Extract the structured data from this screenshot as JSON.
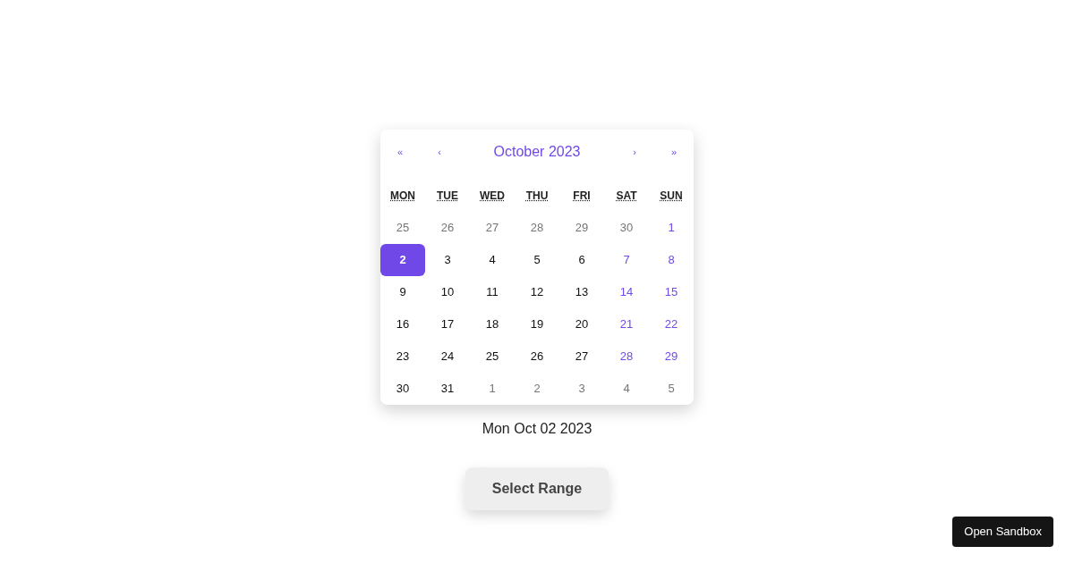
{
  "calendar": {
    "nav": {
      "prev_year": "«",
      "prev_month": "‹",
      "title": "October 2023",
      "next_month": "›",
      "next_year": "»"
    },
    "weekdays": [
      "MON",
      "TUE",
      "WED",
      "THU",
      "FRI",
      "SAT",
      "SUN"
    ],
    "weeks": [
      [
        {
          "day": "25",
          "kind": "outside",
          "selected": false
        },
        {
          "day": "26",
          "kind": "outside",
          "selected": false
        },
        {
          "day": "27",
          "kind": "outside",
          "selected": false
        },
        {
          "day": "28",
          "kind": "outside",
          "selected": false
        },
        {
          "day": "29",
          "kind": "outside",
          "selected": false
        },
        {
          "day": "30",
          "kind": "outside",
          "selected": false
        },
        {
          "day": "1",
          "kind": "weekend",
          "selected": false
        }
      ],
      [
        {
          "day": "2",
          "kind": "weekday",
          "selected": true
        },
        {
          "day": "3",
          "kind": "weekday",
          "selected": false
        },
        {
          "day": "4",
          "kind": "weekday",
          "selected": false
        },
        {
          "day": "5",
          "kind": "weekday",
          "selected": false
        },
        {
          "day": "6",
          "kind": "weekday",
          "selected": false
        },
        {
          "day": "7",
          "kind": "weekend",
          "selected": false
        },
        {
          "day": "8",
          "kind": "weekend",
          "selected": false
        }
      ],
      [
        {
          "day": "9",
          "kind": "weekday",
          "selected": false
        },
        {
          "day": "10",
          "kind": "weekday",
          "selected": false
        },
        {
          "day": "11",
          "kind": "weekday",
          "selected": false
        },
        {
          "day": "12",
          "kind": "weekday",
          "selected": false
        },
        {
          "day": "13",
          "kind": "weekday",
          "selected": false
        },
        {
          "day": "14",
          "kind": "weekend",
          "selected": false
        },
        {
          "day": "15",
          "kind": "weekend",
          "selected": false
        }
      ],
      [
        {
          "day": "16",
          "kind": "weekday",
          "selected": false
        },
        {
          "day": "17",
          "kind": "weekday",
          "selected": false
        },
        {
          "day": "18",
          "kind": "weekday",
          "selected": false
        },
        {
          "day": "19",
          "kind": "weekday",
          "selected": false
        },
        {
          "day": "20",
          "kind": "weekday",
          "selected": false
        },
        {
          "day": "21",
          "kind": "weekend",
          "selected": false
        },
        {
          "day": "22",
          "kind": "weekend",
          "selected": false
        }
      ],
      [
        {
          "day": "23",
          "kind": "weekday",
          "selected": false
        },
        {
          "day": "24",
          "kind": "weekday",
          "selected": false
        },
        {
          "day": "25",
          "kind": "weekday",
          "selected": false
        },
        {
          "day": "26",
          "kind": "weekday",
          "selected": false
        },
        {
          "day": "27",
          "kind": "weekday",
          "selected": false
        },
        {
          "day": "28",
          "kind": "weekend",
          "selected": false
        },
        {
          "day": "29",
          "kind": "weekend",
          "selected": false
        }
      ],
      [
        {
          "day": "30",
          "kind": "weekday",
          "selected": false
        },
        {
          "day": "31",
          "kind": "weekday",
          "selected": false
        },
        {
          "day": "1",
          "kind": "outside",
          "selected": false
        },
        {
          "day": "2",
          "kind": "outside",
          "selected": false
        },
        {
          "day": "3",
          "kind": "outside",
          "selected": false
        },
        {
          "day": "4",
          "kind": "outside",
          "selected": false
        },
        {
          "day": "5",
          "kind": "outside",
          "selected": false
        }
      ]
    ]
  },
  "selected_date": "Mon Oct 02 2023",
  "range_button": "Select Range",
  "sandbox_button": "Open Sandbox"
}
